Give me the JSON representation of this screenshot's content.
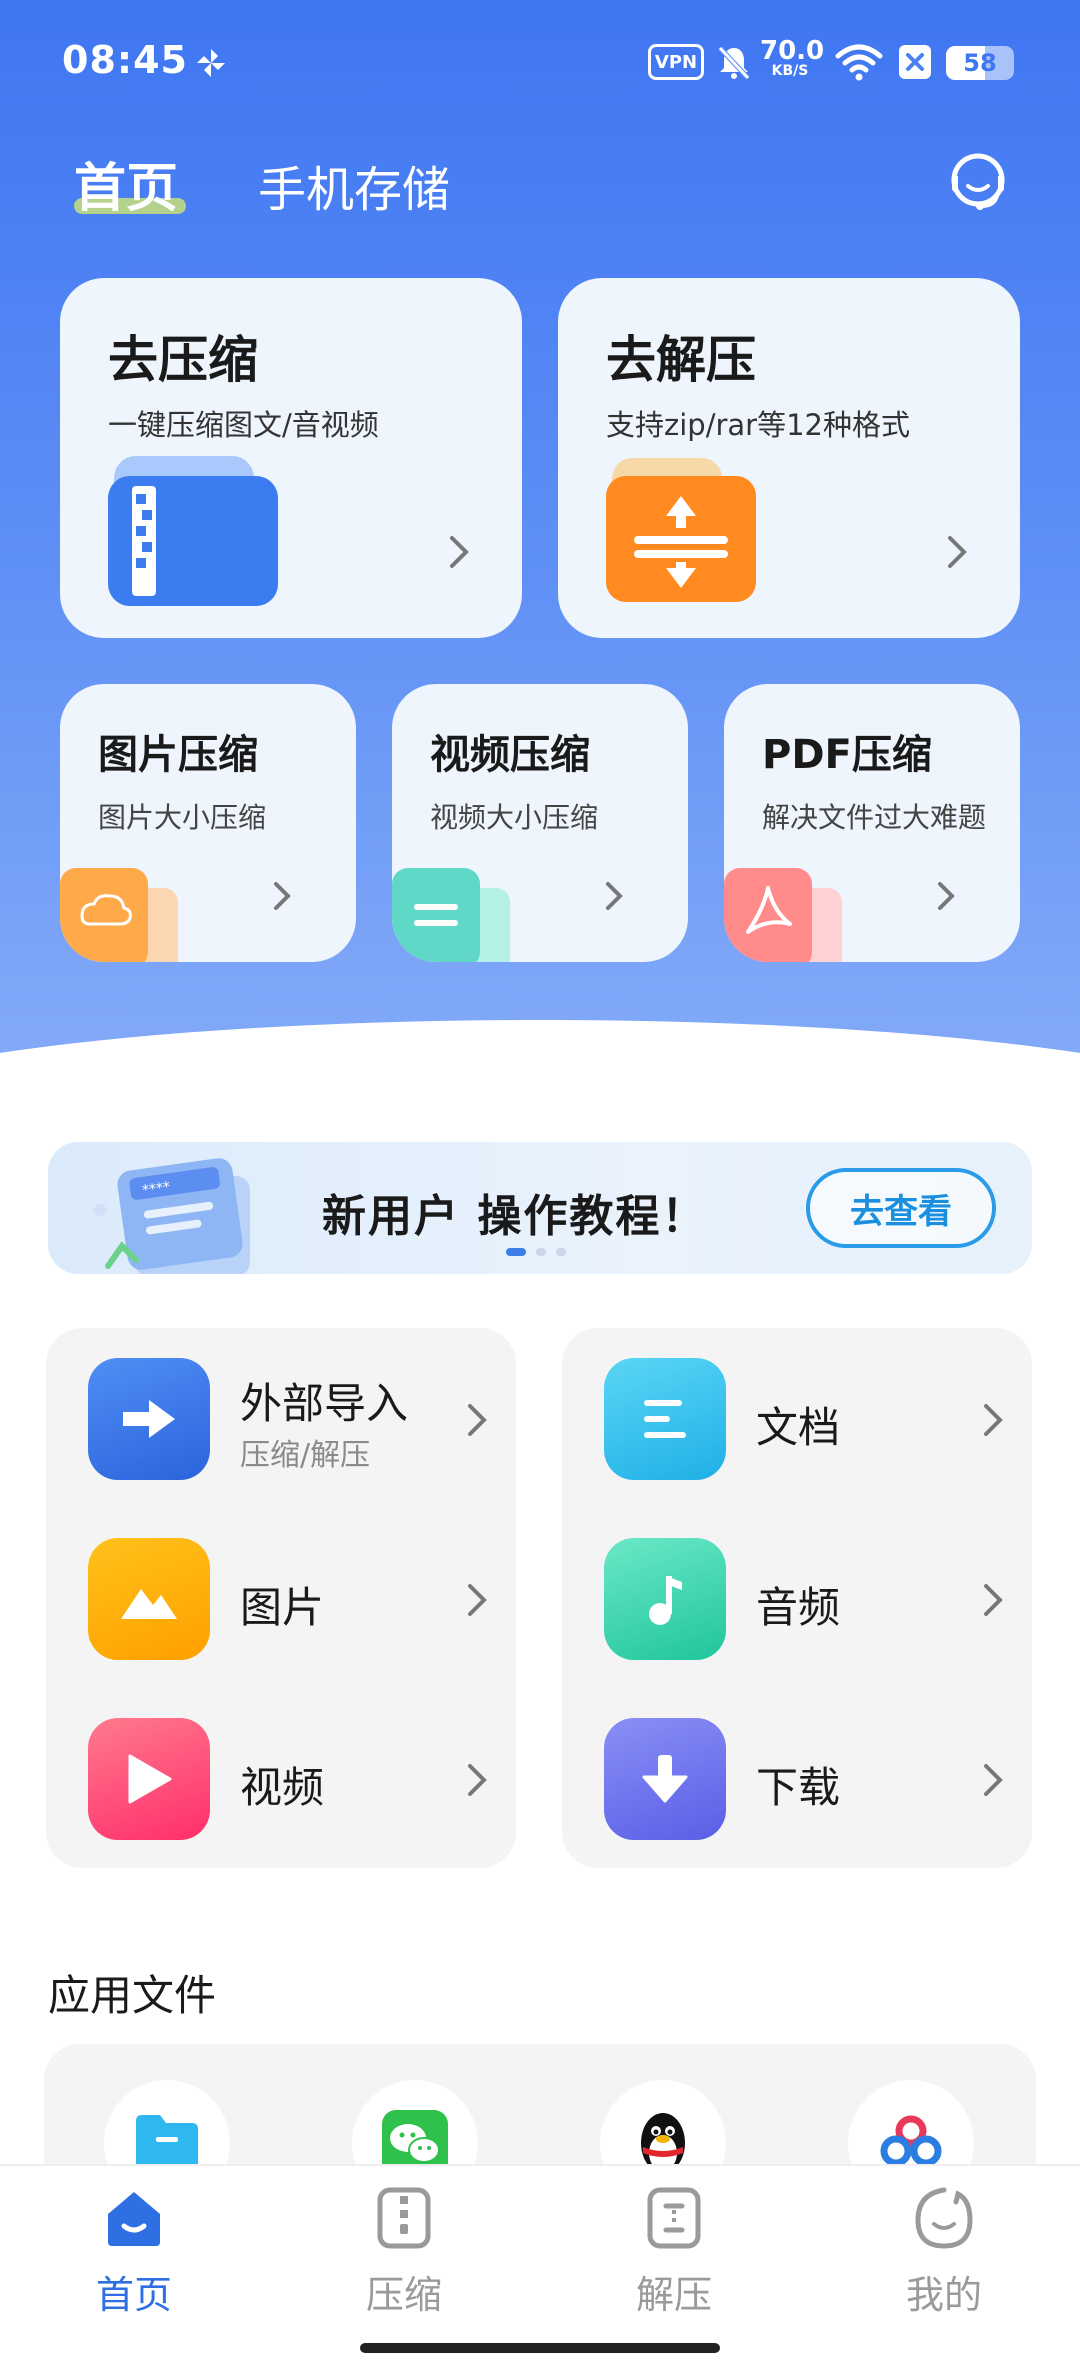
{
  "status_bar": {
    "time": "08:45",
    "vpn_label": "VPN",
    "net_speed_value": "70.0",
    "net_speed_unit": "KB/S",
    "battery_level": "58",
    "battery_fraction": 0.58
  },
  "header": {
    "tabs": [
      {
        "label": "首页",
        "active": true
      },
      {
        "label": "手机存储",
        "active": false
      }
    ],
    "support_icon": "headset-icon"
  },
  "big_cards": [
    {
      "title": "去压缩",
      "subtitle": "一键压缩图文/音视频",
      "icon": "zip-folder-icon",
      "color": "#3b7cf0"
    },
    {
      "title": "去解压",
      "subtitle": "支持zip/rar等12种格式",
      "icon": "unzip-folder-icon",
      "color": "#ff8a1f"
    }
  ],
  "small_cards": [
    {
      "title": "图片压缩",
      "subtitle": "图片大小压缩",
      "icon": "cloud-image-icon",
      "color": "#ffaa4a"
    },
    {
      "title": "视频压缩",
      "subtitle": "视频大小压缩",
      "icon": "video-doc-icon",
      "color": "#5fd8c8"
    },
    {
      "title": "PDF压缩",
      "subtitle": "解决文件过大难题",
      "icon": "pdf-icon",
      "color": "#ff8b8b"
    }
  ],
  "banner": {
    "title": "新用户 操作教程！",
    "button_label": "去查看",
    "page_count": 3,
    "active_page": 1
  },
  "left_grid": [
    {
      "label": "外部导入",
      "sublabel": "压缩/解压",
      "icon": "arrow-right-icon",
      "color": "#3a7be8"
    },
    {
      "label": "图片",
      "sublabel": "",
      "icon": "mountain-image-icon",
      "color": "#ffb300"
    },
    {
      "label": "视频",
      "sublabel": "",
      "icon": "play-icon",
      "color": "#ff4d7a"
    }
  ],
  "right_grid": [
    {
      "label": "文档",
      "icon": "document-lines-icon",
      "color": "#35c2ea"
    },
    {
      "label": "音频",
      "icon": "music-note-icon",
      "color": "#3ed6b0"
    },
    {
      "label": "下载",
      "icon": "download-arrow-icon",
      "color": "#6f73ee"
    }
  ],
  "section_title": "应用文件",
  "app_icons": [
    "folder-icon",
    "wechat-icon",
    "qq-penguin-icon",
    "baidu-netdisk-icon"
  ],
  "bottom_nav": [
    {
      "label": "首页",
      "icon": "home-icon",
      "active": true
    },
    {
      "label": "压缩",
      "icon": "compress-icon",
      "active": false
    },
    {
      "label": "解压",
      "icon": "decompress-icon",
      "active": false
    },
    {
      "label": "我的",
      "icon": "profile-face-icon",
      "active": false
    }
  ]
}
